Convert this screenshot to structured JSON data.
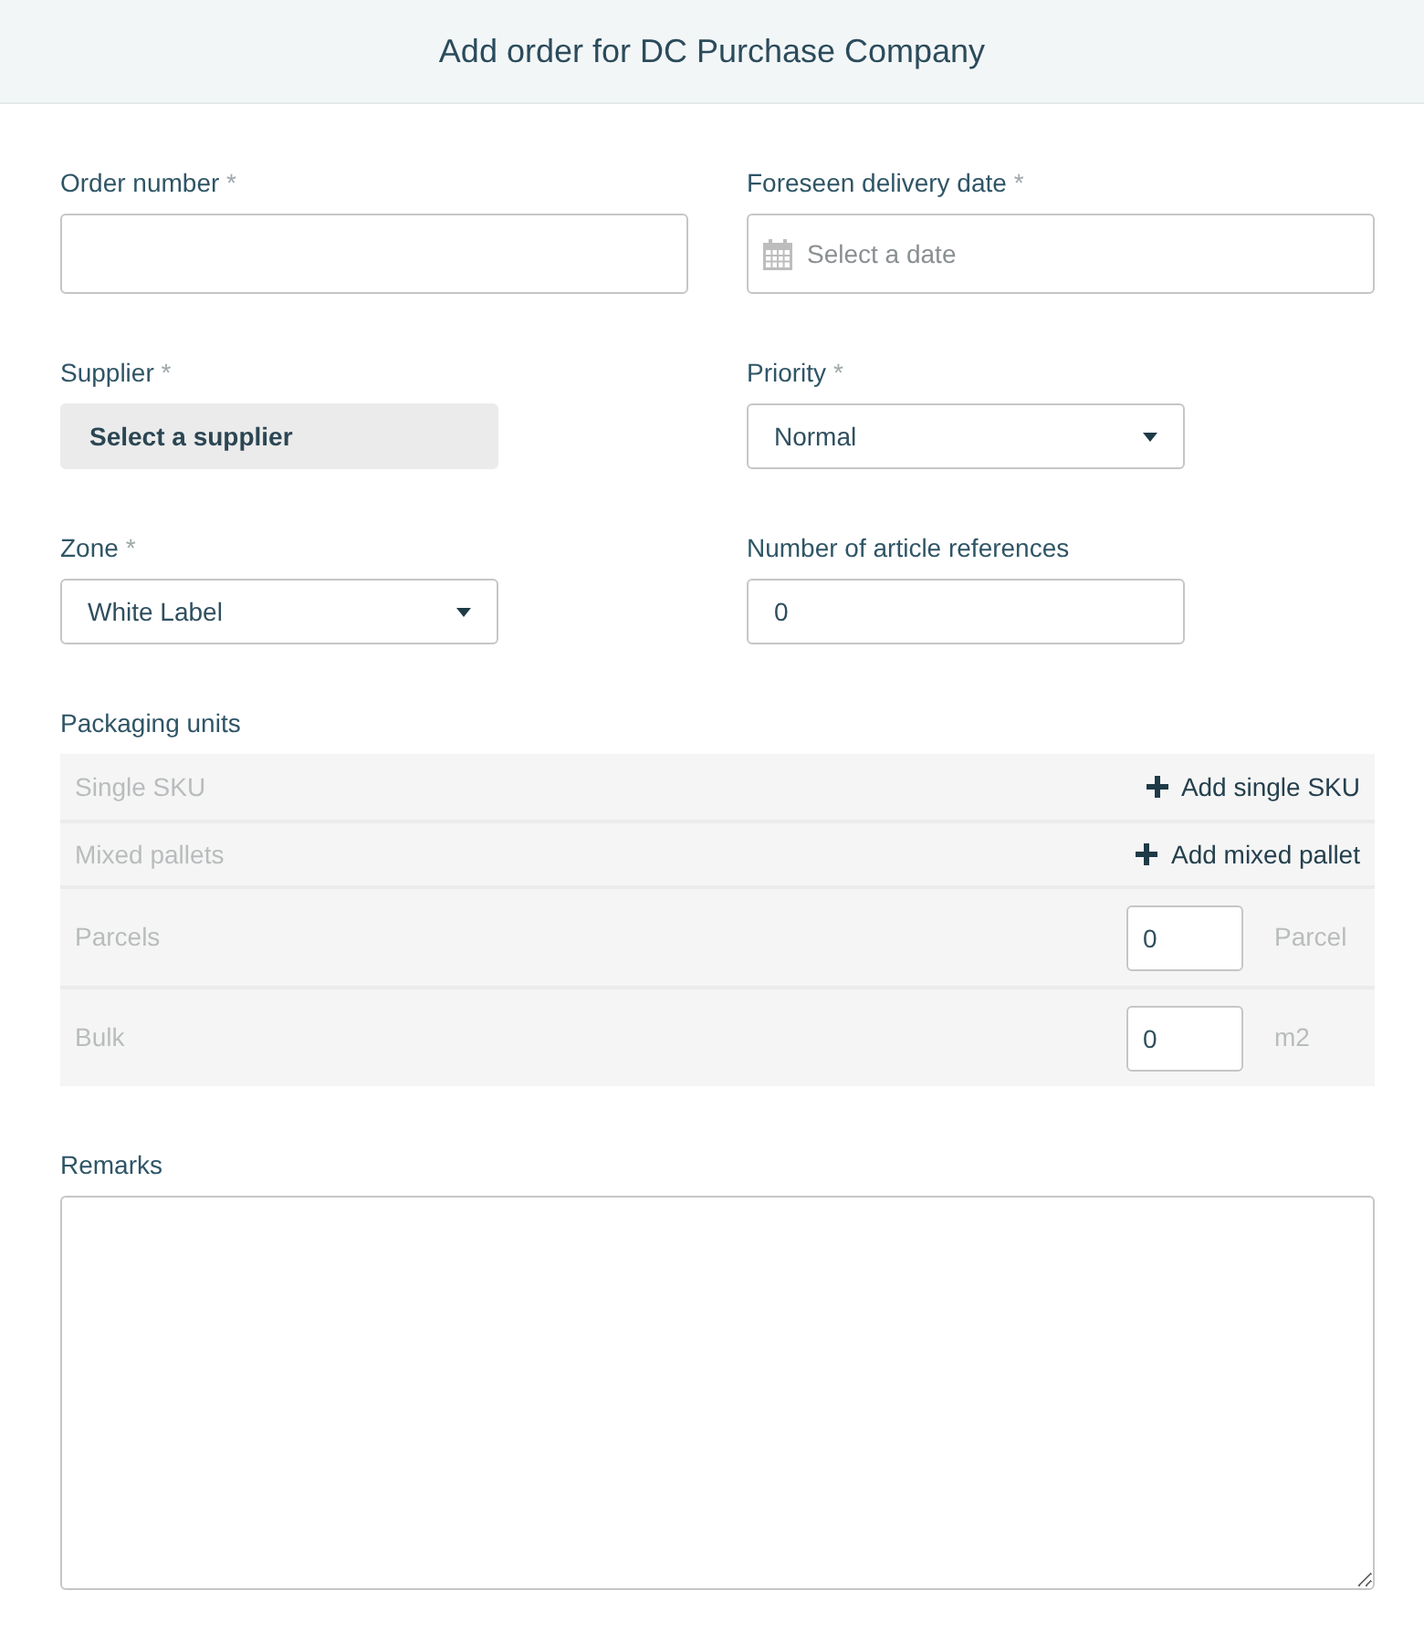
{
  "header": {
    "title": "Add order for DC Purchase Company"
  },
  "fields": [
    {
      "kind": "text",
      "label": "Order number",
      "required_mark": "*"
    },
    {
      "kind": "date",
      "label": "Foreseen delivery date",
      "required_mark": "*",
      "placeholder": "Select a date"
    },
    {
      "kind": "picker",
      "label": "Supplier",
      "required_mark": "*",
      "button_label": "Select a supplier"
    },
    {
      "kind": "select",
      "label": "Priority",
      "required_mark": "*",
      "value": "Normal"
    },
    {
      "kind": "select",
      "label": "Zone",
      "required_mark": "*",
      "value": "White Label"
    },
    {
      "kind": "number",
      "label": "Number of article references",
      "value": "0"
    }
  ],
  "packaging_units": {
    "label": "Packaging units",
    "rows": [
      {
        "kind": "action",
        "label": "Single SKU",
        "action": "Add single SKU"
      },
      {
        "kind": "action",
        "label": "Mixed pallets",
        "action": "Add mixed pallet"
      },
      {
        "kind": "quantity",
        "label": "Parcels",
        "value": "0",
        "unit": "Parcel"
      },
      {
        "kind": "quantity",
        "label": "Bulk",
        "value": "0",
        "unit": "m2"
      }
    ]
  },
  "remarks": {
    "label": "Remarks"
  }
}
